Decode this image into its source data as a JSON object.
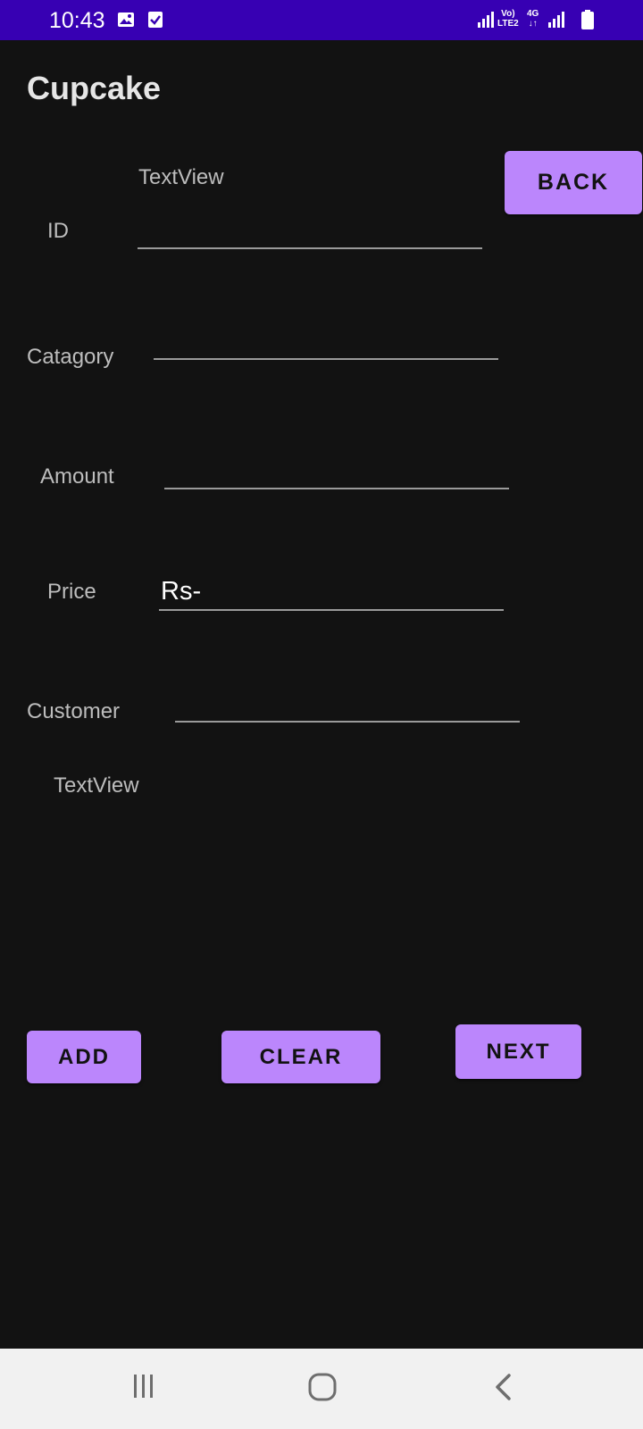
{
  "status_bar": {
    "time": "10:43",
    "network_label_top": "Vo)",
    "network_label_bottom": "LTE2",
    "network_4g": "4G"
  },
  "app": {
    "title": "Cupcake"
  },
  "form": {
    "top_textview": "TextView",
    "id_label": "ID",
    "id_value": "",
    "category_label": "Catagory",
    "category_value": "",
    "amount_label": "Amount",
    "amount_value": "",
    "price_label": "Price",
    "price_value": "Rs-",
    "customer_label": "Customer",
    "customer_value": "",
    "bottom_textview": "TextView"
  },
  "buttons": {
    "back": "BACK",
    "add": "ADD",
    "clear": "CLEAR",
    "next": "NEXT"
  },
  "colors": {
    "status_bar": "#3700B3",
    "background": "#121212",
    "button": "#BB86FC",
    "nav_bar": "#f1f1f1"
  },
  "nav_bar": {
    "icons": [
      "recent-apps-icon",
      "home-icon",
      "back-icon"
    ]
  }
}
